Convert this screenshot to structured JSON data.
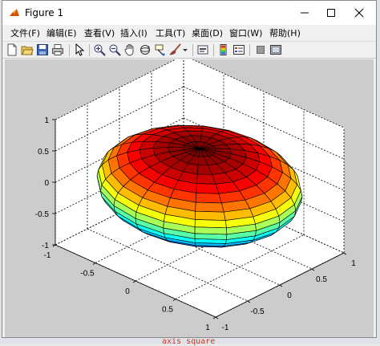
{
  "window": {
    "title": "Figure 1"
  },
  "controls": {
    "minimize": "minimize",
    "maximize": "maximize",
    "close": "close"
  },
  "menu": [
    {
      "label": "文件(F)"
    },
    {
      "label": "编辑(E)"
    },
    {
      "label": "查看(V)"
    },
    {
      "label": "插入(I)"
    },
    {
      "label": "工具(T)"
    },
    {
      "label": "桌面(D)"
    },
    {
      "label": "窗口(W)"
    },
    {
      "label": "帮助(H)"
    }
  ],
  "toolbar": {
    "buttons": [
      {
        "icon": "new-figure-icon"
      },
      {
        "icon": "open-file-icon"
      },
      {
        "icon": "save-icon"
      },
      {
        "icon": "print-icon"
      },
      {
        "icon": "edit-plot-arrow-icon"
      },
      {
        "icon": "zoom-in-icon"
      },
      {
        "icon": "zoom-out-icon"
      },
      {
        "icon": "pan-hand-icon"
      },
      {
        "icon": "rotate-3d-icon"
      },
      {
        "icon": "data-cursor-icon"
      },
      {
        "icon": "brush-icon"
      },
      {
        "icon": "brush-dropdown-icon"
      },
      {
        "icon": "link-plot-icon"
      },
      {
        "icon": "insert-colorbar-icon"
      },
      {
        "icon": "insert-legend-icon"
      },
      {
        "icon": "hide-plot-tools-icon"
      },
      {
        "icon": "show-plot-tools-icon"
      }
    ]
  },
  "chart_data": {
    "type": "surface",
    "shape": "oblate ellipsoid",
    "colormap": "jet",
    "semi_axes": {
      "x": 1,
      "y": 1,
      "z": 0.6
    },
    "grid": true,
    "box": true,
    "view": {
      "azimuth": -37.5,
      "elevation": 30
    },
    "xlim": [
      -1,
      1
    ],
    "ylim": [
      -1,
      1
    ],
    "zlim": [
      -1,
      1
    ],
    "xticks": [
      "-1",
      "-0.5",
      "0",
      "0.5",
      "1"
    ],
    "yticks": [
      "-1",
      "-0.5",
      "0",
      "0.5",
      "1"
    ],
    "zticks": [
      "-1",
      "-0.5",
      "0",
      "0.5",
      "1"
    ]
  },
  "background_text": "axis square"
}
